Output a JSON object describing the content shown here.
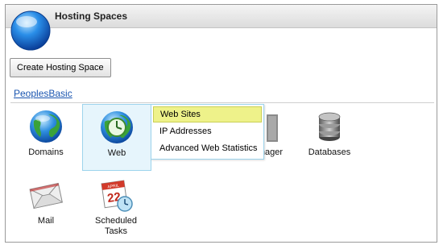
{
  "header": {
    "title": "Hosting Spaces"
  },
  "toolbar": {
    "create_label": "Create Hosting Space"
  },
  "group": {
    "title": "PeoplesBasic"
  },
  "tiles": {
    "domains": "Domains",
    "web": "Web",
    "file_manager_partial": "nager",
    "databases": "Databases",
    "mail": "Mail",
    "scheduled_tasks_line1": "Scheduled",
    "scheduled_tasks_line2": "Tasks"
  },
  "calendar_icon": {
    "month": "APRIL",
    "day": "22"
  },
  "menu": {
    "items": [
      {
        "label": "Web Sites",
        "highlighted": true
      },
      {
        "label": "IP Addresses",
        "highlighted": false
      },
      {
        "label": "Advanced Web Statistics",
        "highlighted": false
      }
    ]
  },
  "colors": {
    "link": "#1a55b0",
    "selected_tile_bg": "#e6f5fc",
    "menu_highlight": "#eef28a"
  }
}
